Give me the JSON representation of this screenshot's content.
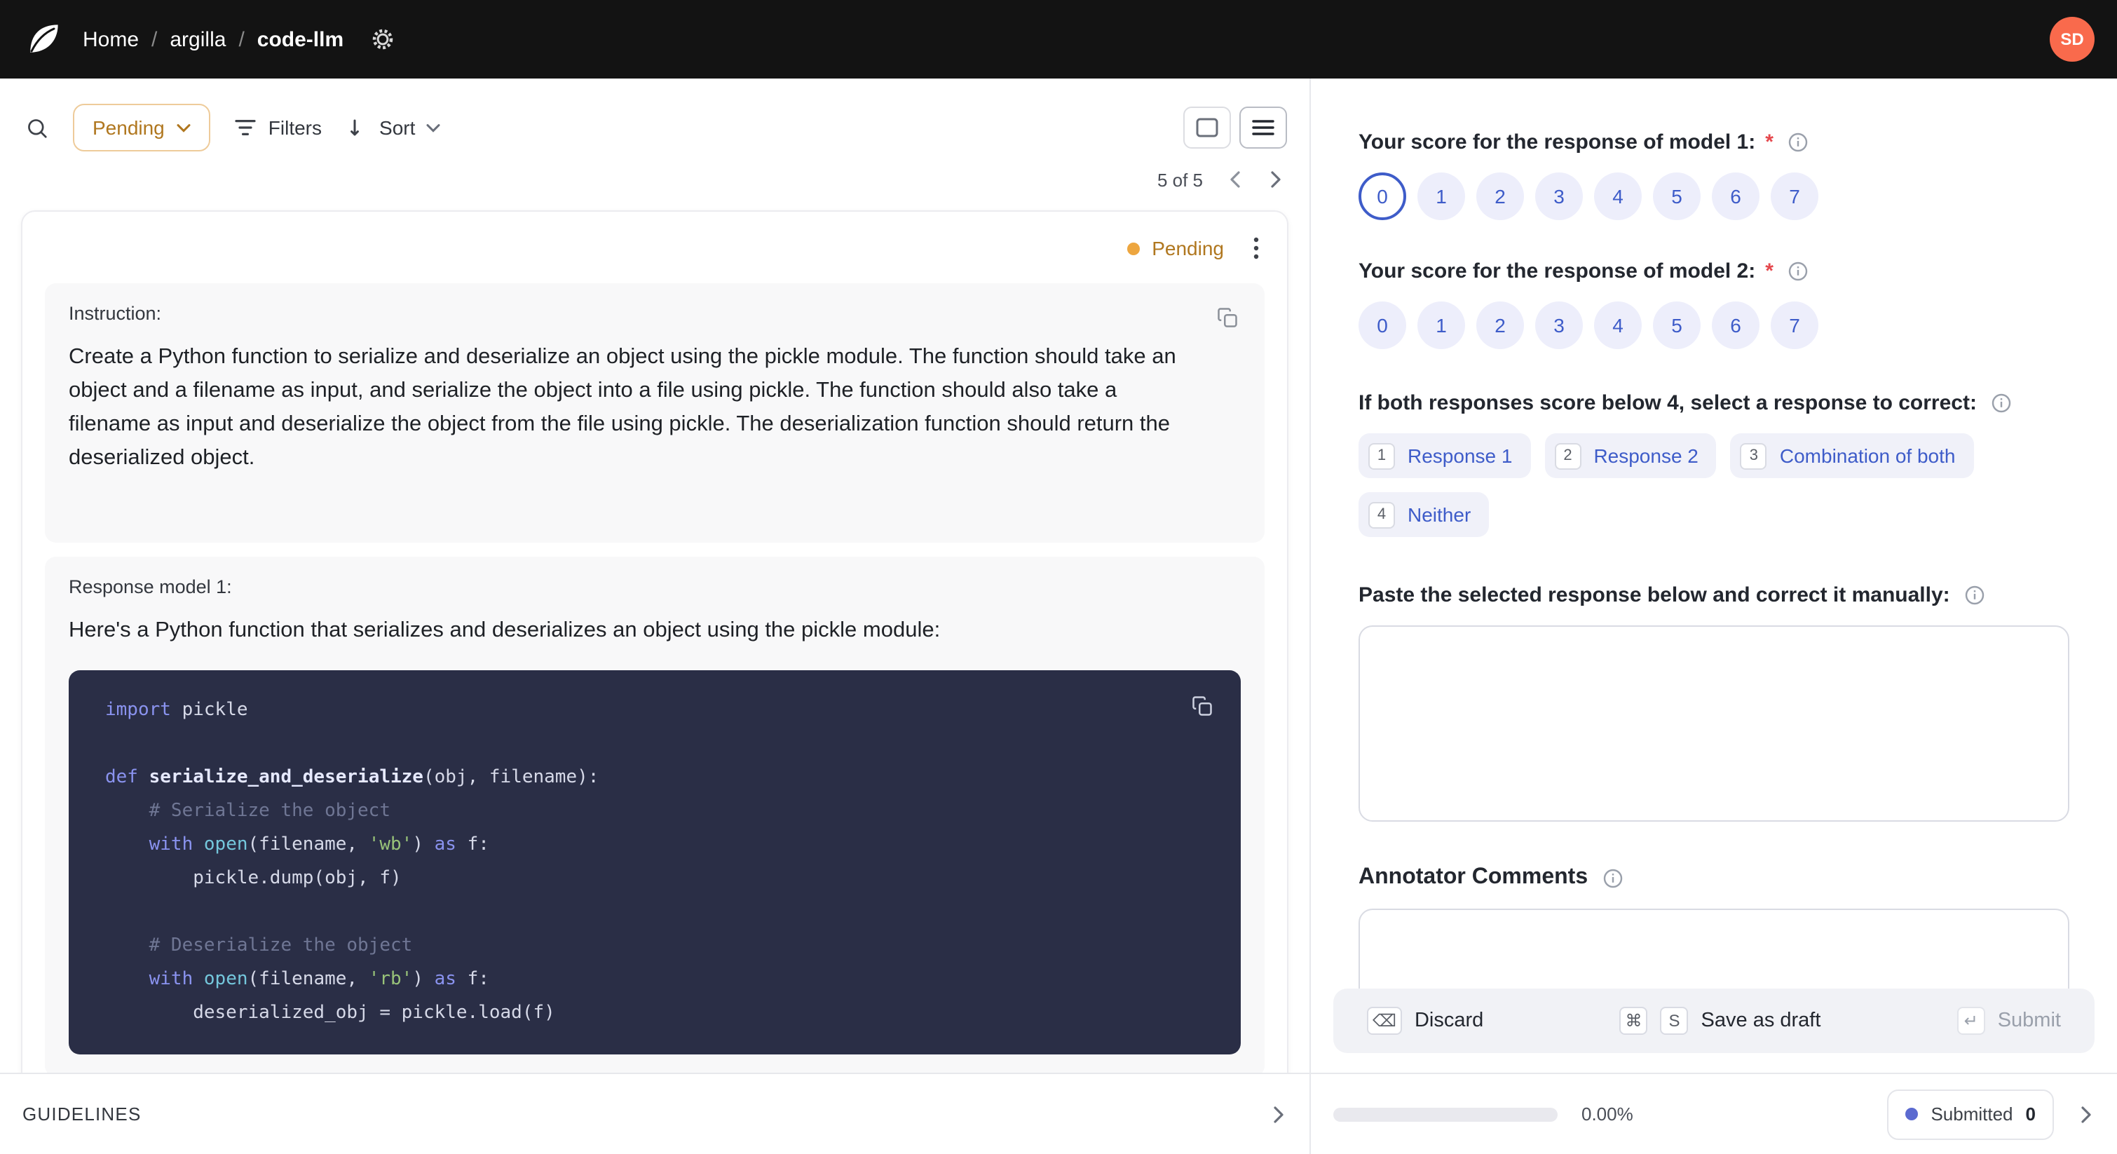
{
  "header": {
    "breadcrumb": {
      "home": "Home",
      "separator": "/",
      "workspace": "argilla",
      "dataset": "code-llm"
    },
    "avatar_initials": "SD"
  },
  "toolbar": {
    "status_filter_label": "Pending",
    "filters_label": "Filters",
    "sort_label": "Sort"
  },
  "pagination": {
    "label": "5 of 5"
  },
  "record": {
    "status_label": "Pending",
    "instruction": {
      "title": "Instruction:",
      "text": "Create a Python function to serialize and deserialize an object using the pickle module. The function should take an object and a filename as input, and serialize the object into a file using pickle. The function should also take a filename as input and deserialize the object from the file using pickle. The deserialization function should return the deserialized object."
    },
    "response1": {
      "title": "Response model 1:",
      "intro": "Here's a Python function that serializes and deserializes an object using the pickle module:"
    },
    "code_lines": [
      [
        {
          "c": "kw",
          "t": "import"
        },
        {
          "c": "pl",
          "t": " pickle"
        }
      ],
      [],
      [
        {
          "c": "kw",
          "t": "def"
        },
        {
          "c": "fn",
          "t": " serialize_and_deserialize"
        },
        {
          "c": "pl",
          "t": "(obj, filename):"
        }
      ],
      [
        {
          "c": "cm",
          "t": "    # Serialize the object"
        }
      ],
      [
        {
          "c": "pl",
          "t": "    "
        },
        {
          "c": "kw",
          "t": "with"
        },
        {
          "c": "pl",
          "t": " "
        },
        {
          "c": "bi",
          "t": "open"
        },
        {
          "c": "pl",
          "t": "(filename, "
        },
        {
          "c": "st",
          "t": "'wb'"
        },
        {
          "c": "pl",
          "t": ") "
        },
        {
          "c": "kw",
          "t": "as"
        },
        {
          "c": "pl",
          "t": " f:"
        }
      ],
      [
        {
          "c": "pl",
          "t": "        pickle.dump(obj, f)"
        }
      ],
      [],
      [
        {
          "c": "cm",
          "t": "    # Deserialize the object"
        }
      ],
      [
        {
          "c": "pl",
          "t": "    "
        },
        {
          "c": "kw",
          "t": "with"
        },
        {
          "c": "pl",
          "t": " "
        },
        {
          "c": "bi",
          "t": "open"
        },
        {
          "c": "pl",
          "t": "(filename, "
        },
        {
          "c": "st",
          "t": "'rb'"
        },
        {
          "c": "pl",
          "t": ") "
        },
        {
          "c": "kw",
          "t": "as"
        },
        {
          "c": "pl",
          "t": " f:"
        }
      ],
      [
        {
          "c": "pl",
          "t": "        deserialized_obj = pickle.load(f)"
        }
      ]
    ]
  },
  "questions": {
    "rating1": {
      "title": "Your score for the response of model 1:",
      "required_mark": "*",
      "options": [
        "0",
        "1",
        "2",
        "3",
        "4",
        "5",
        "6",
        "7"
      ],
      "selected_index": 0
    },
    "rating2": {
      "title": "Your score for the response of model 2:",
      "required_mark": "*",
      "options": [
        "0",
        "1",
        "2",
        "3",
        "4",
        "5",
        "6",
        "7"
      ],
      "selected_index": -1
    },
    "label_select": {
      "title": "If both responses score below 4, select a response to correct:",
      "options": [
        {
          "shortcut": "1",
          "label": "Response 1"
        },
        {
          "shortcut": "2",
          "label": "Response 2"
        },
        {
          "shortcut": "3",
          "label": "Combination of both"
        },
        {
          "shortcut": "4",
          "label": "Neither"
        }
      ]
    },
    "correction": {
      "title": "Paste the selected response below and correct it manually:",
      "value": ""
    },
    "comments": {
      "title": "Annotator Comments",
      "value": ""
    }
  },
  "actions": {
    "discard_label": "Discard",
    "discard_key": "⌫",
    "save_label": "Save as draft",
    "save_keys": [
      "⌘",
      "S"
    ],
    "submit_label": "Submit",
    "submit_key": "↵"
  },
  "footer": {
    "guidelines_label": "GUIDELINES",
    "progress_percent": "0.00%",
    "progress_value": 0,
    "submitted_label": "Submitted",
    "submitted_count": "0"
  },
  "colors": {
    "accent_blue": "#3e5cc9",
    "pending_text": "#b0771f",
    "pending_dot": "#eda63f",
    "submitted_dot": "#5b6ad0",
    "avatar_bg": "#f96a4c",
    "code_background": "#2a2e46"
  }
}
